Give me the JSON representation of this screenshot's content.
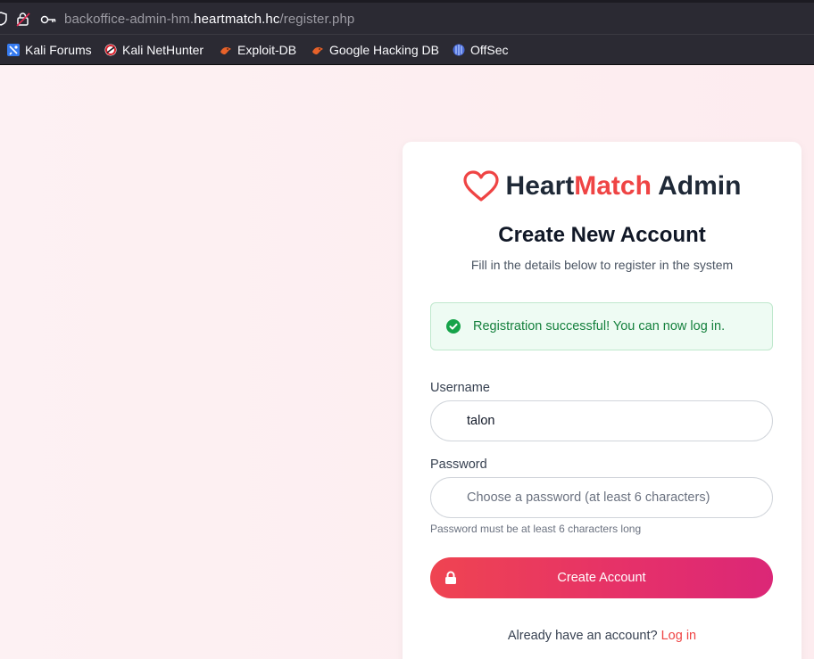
{
  "browser": {
    "url_prefix": "backoffice-admin-hm.",
    "url_host": "heartmatch.hc",
    "url_path": "/register.php",
    "bookmarks": [
      {
        "label": "Kali Forums",
        "icon": "kali-forums-icon"
      },
      {
        "label": "Kali NetHunter",
        "icon": "kali-nethunter-icon"
      },
      {
        "label": "Exploit-DB",
        "icon": "exploit-db-icon"
      },
      {
        "label": "Google Hacking DB",
        "icon": "google-hacking-db-icon"
      },
      {
        "label": "OffSec",
        "icon": "offsec-icon"
      }
    ]
  },
  "brand": {
    "part1": "Heart",
    "part2": "Match",
    "part3": " Admin",
    "accent_color": "#ef4444"
  },
  "form": {
    "title": "Create New Account",
    "subtitle": "Fill in the details below to register in the system",
    "alert": "Registration successful! You can now log in.",
    "username_label": "Username",
    "username_value": "talon",
    "password_label": "Password",
    "password_placeholder": "Choose a password (at least 6 characters)",
    "password_hint": "Password must be at least 6 characters long",
    "submit_label": "Create Account",
    "footer_text": "Already have an account?",
    "login_link": "Log in"
  }
}
